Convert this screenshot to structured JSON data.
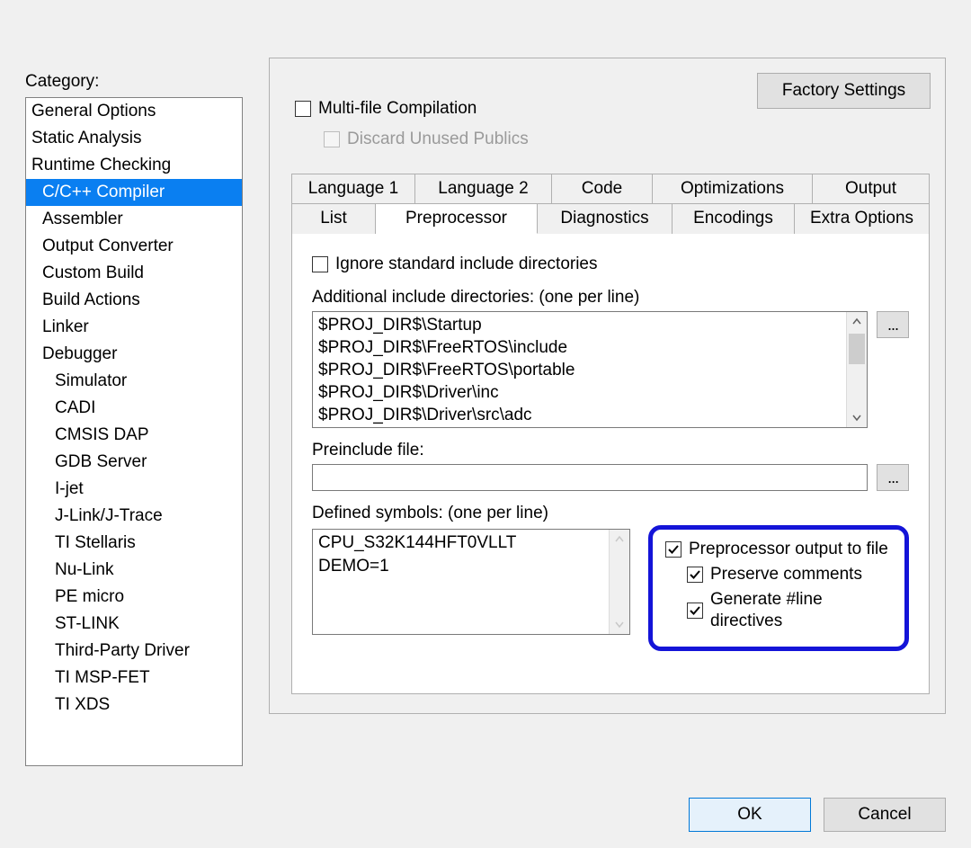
{
  "category_label": "Category:",
  "categories": [
    {
      "label": "General Options",
      "indent": 0
    },
    {
      "label": "Static Analysis",
      "indent": 0
    },
    {
      "label": "Runtime Checking",
      "indent": 0
    },
    {
      "label": "C/C++ Compiler",
      "indent": 1,
      "selected": true
    },
    {
      "label": "Assembler",
      "indent": 1
    },
    {
      "label": "Output Converter",
      "indent": 1
    },
    {
      "label": "Custom Build",
      "indent": 1
    },
    {
      "label": "Build Actions",
      "indent": 1
    },
    {
      "label": "Linker",
      "indent": 1
    },
    {
      "label": "Debugger",
      "indent": 1
    },
    {
      "label": "Simulator",
      "indent": 2
    },
    {
      "label": "CADI",
      "indent": 2
    },
    {
      "label": "CMSIS DAP",
      "indent": 2
    },
    {
      "label": "GDB Server",
      "indent": 2
    },
    {
      "label": "I-jet",
      "indent": 2
    },
    {
      "label": "J-Link/J-Trace",
      "indent": 2
    },
    {
      "label": "TI Stellaris",
      "indent": 2
    },
    {
      "label": "Nu-Link",
      "indent": 2
    },
    {
      "label": "PE micro",
      "indent": 2
    },
    {
      "label": "ST-LINK",
      "indent": 2
    },
    {
      "label": "Third-Party Driver",
      "indent": 2
    },
    {
      "label": "TI MSP-FET",
      "indent": 2
    },
    {
      "label": "TI XDS",
      "indent": 2
    }
  ],
  "factory_settings": "Factory Settings",
  "multi_file_compilation": "Multi-file Compilation",
  "discard_unused_publics": "Discard Unused Publics",
  "tabs_row1": [
    "Language 1",
    "Language 2",
    "Code",
    "Optimizations",
    "Output"
  ],
  "tabs_row2": [
    "List",
    "Preprocessor",
    "Diagnostics",
    "Encodings",
    "Extra Options"
  ],
  "active_tab": "Preprocessor",
  "ignore_std_include": "Ignore standard include directories",
  "additional_include_label": "Additional include directories: (one per line)",
  "additional_include_value": "$PROJ_DIR$\\Startup\n$PROJ_DIR$\\FreeRTOS\\include\n$PROJ_DIR$\\FreeRTOS\\portable\n$PROJ_DIR$\\Driver\\inc\n$PROJ_DIR$\\Driver\\src\\adc",
  "preinclude_label": "Preinclude file:",
  "preinclude_value": "",
  "defined_symbols_label": "Defined symbols: (one per line)",
  "defined_symbols_value": "CPU_S32K144HFT0VLLT\nDEMO=1",
  "pp_output_to_file": "Preprocessor output to file",
  "preserve_comments": "Preserve comments",
  "generate_line_directives": "Generate #line directives",
  "browse": "...",
  "ok": "OK",
  "cancel": "Cancel"
}
